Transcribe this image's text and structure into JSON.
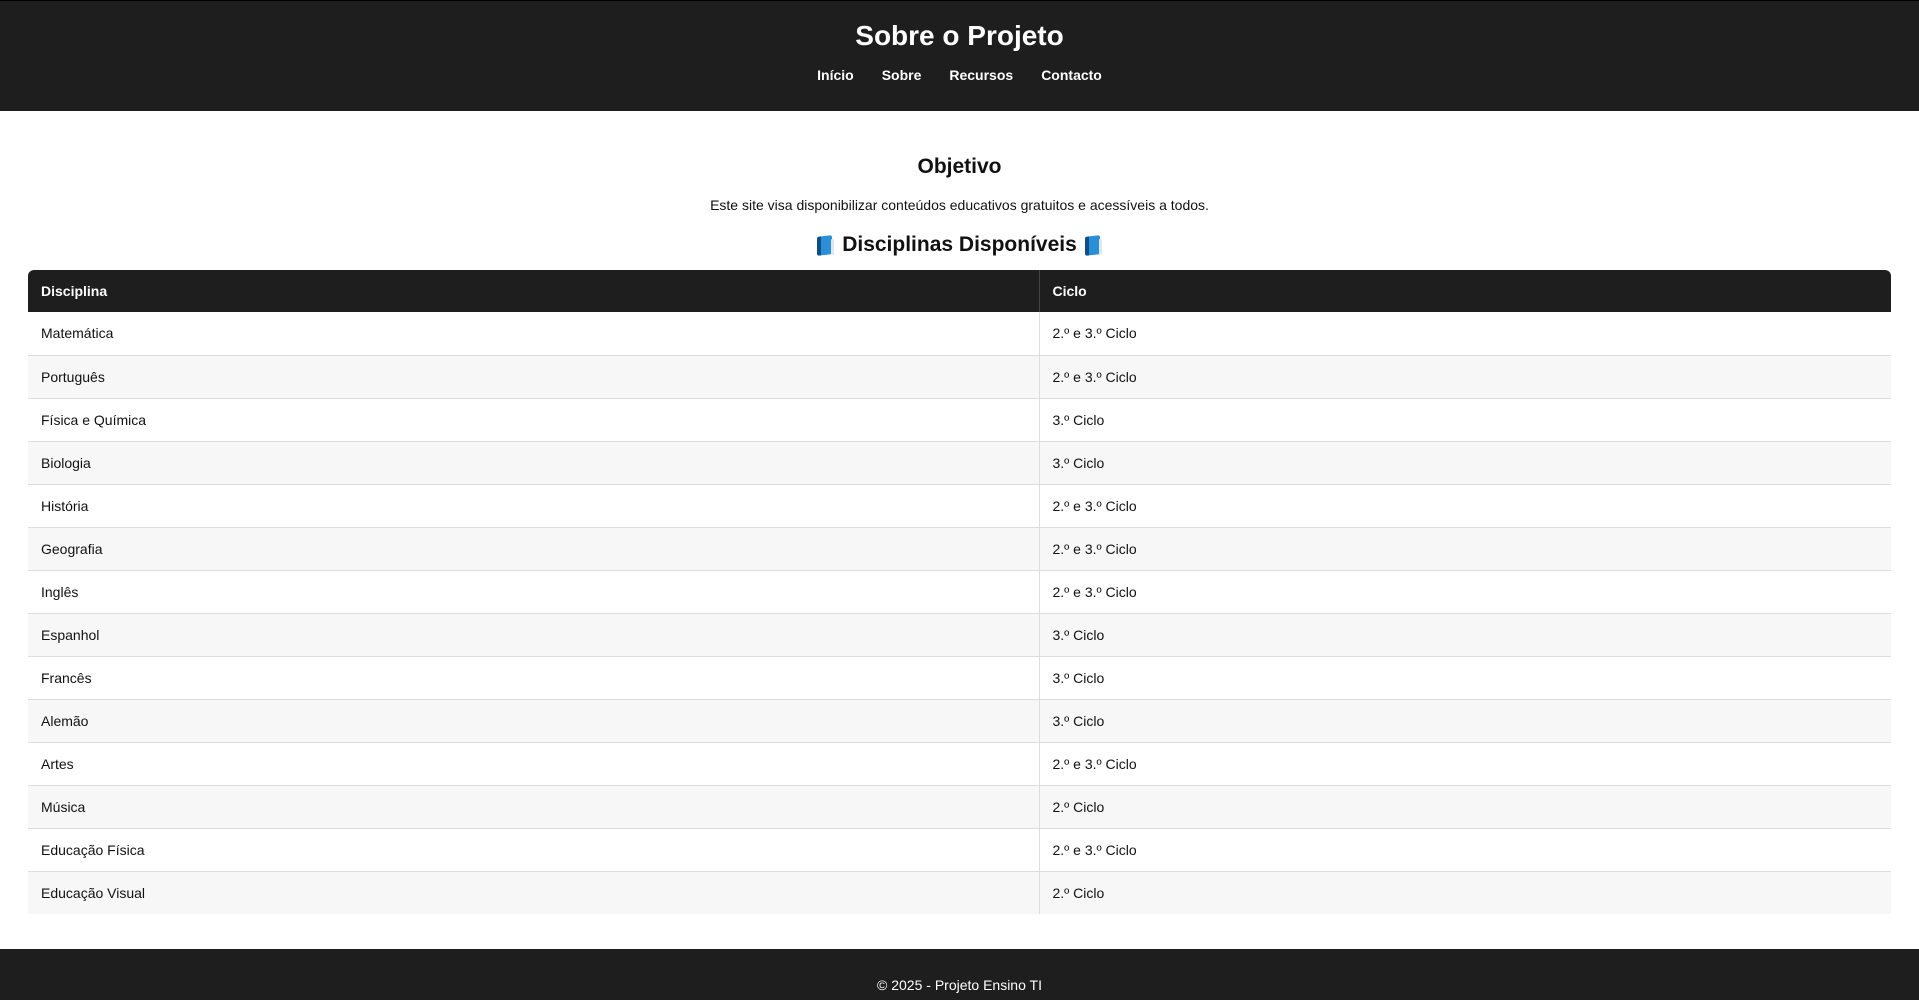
{
  "header": {
    "title": "Sobre o Projeto",
    "nav": [
      {
        "label": "Início"
      },
      {
        "label": "Sobre"
      },
      {
        "label": "Recursos"
      },
      {
        "label": "Contacto"
      }
    ]
  },
  "main": {
    "section_title": "Objetivo",
    "intro": "Este site visa disponibilizar conteúdos educativos gratuitos e acessíveis a todos.",
    "table_title": "Disciplinas Disponíveis",
    "table_title_icon": "blue-book-icon",
    "table": {
      "columns": [
        "Disciplina",
        "Ciclo"
      ],
      "rows": [
        [
          "Matemática",
          "2.º e 3.º Ciclo"
        ],
        [
          "Português",
          "2.º e 3.º Ciclo"
        ],
        [
          "Física e Química",
          "3.º Ciclo"
        ],
        [
          "Biologia",
          "3.º Ciclo"
        ],
        [
          "História",
          "2.º e 3.º Ciclo"
        ],
        [
          "Geografia",
          "2.º e 3.º Ciclo"
        ],
        [
          "Inglês",
          "2.º e 3.º Ciclo"
        ],
        [
          "Espanhol",
          "3.º Ciclo"
        ],
        [
          "Francês",
          "3.º Ciclo"
        ],
        [
          "Alemão",
          "3.º Ciclo"
        ],
        [
          "Artes",
          "2.º e 3.º Ciclo"
        ],
        [
          "Música",
          "2.º Ciclo"
        ],
        [
          "Educação Física",
          "2.º e 3.º Ciclo"
        ],
        [
          "Educação Visual",
          "2.º Ciclo"
        ]
      ]
    }
  },
  "footer": {
    "text": "© 2025 - Projeto Ensino TI"
  },
  "colors": {
    "header_bg": "#1e1e1e",
    "row_alt_bg": "#f7f7f7",
    "text": "#111111"
  }
}
